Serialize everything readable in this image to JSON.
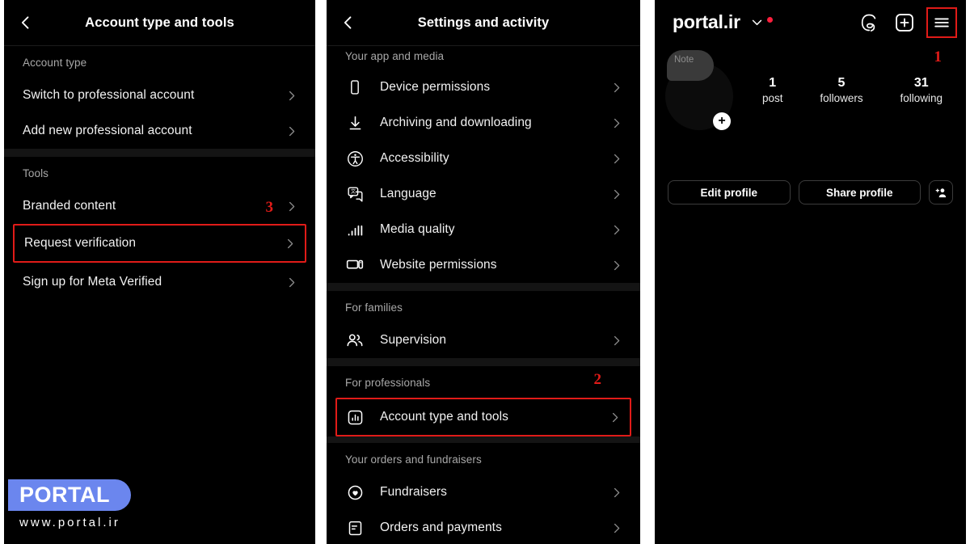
{
  "theme": {
    "background": "#000000",
    "accent_red": "#e01b18",
    "text_primary": "#f2f2f2",
    "text_secondary": "#a8a8a8",
    "watermark_blue": "#6b86ee",
    "notification_dot": "#ff1f3d"
  },
  "panel_account_tools": {
    "title": "Account type and tools",
    "back_icon": "back-chevron-icon",
    "sections": [
      {
        "label": "Account type",
        "items": [
          {
            "label": "Switch to professional account",
            "chevron": "chevron-right-icon",
            "highlighted": false
          },
          {
            "label": "Add new professional account",
            "chevron": "chevron-right-icon",
            "highlighted": false
          }
        ]
      },
      {
        "label": "Tools",
        "items": [
          {
            "label": "Branded content",
            "chevron": "chevron-right-icon",
            "highlighted": false
          },
          {
            "label": "Request verification",
            "chevron": "chevron-right-icon",
            "highlighted": true
          },
          {
            "label": "Sign up for Meta Verified",
            "chevron": "chevron-right-icon",
            "highlighted": false
          }
        ]
      }
    ],
    "step_number": "3"
  },
  "panel_settings": {
    "title": "Settings and activity",
    "back_icon": "back-chevron-icon",
    "sections": [
      {
        "label": "Your app and media",
        "items": [
          {
            "label": "Device permissions",
            "icon": "phone-icon",
            "highlighted": false
          },
          {
            "label": "Archiving and downloading",
            "icon": "download-icon",
            "highlighted": false
          },
          {
            "label": "Accessibility",
            "icon": "accessibility-icon",
            "highlighted": false
          },
          {
            "label": "Language",
            "icon": "language-icon",
            "highlighted": false
          },
          {
            "label": "Media quality",
            "icon": "media-quality-icon",
            "highlighted": false
          },
          {
            "label": "Website permissions",
            "icon": "website-icon",
            "highlighted": false
          }
        ]
      },
      {
        "label": "For families",
        "items": [
          {
            "label": "Supervision",
            "icon": "supervision-icon",
            "highlighted": false
          }
        ]
      },
      {
        "label": "For professionals",
        "items": [
          {
            "label": "Account type and tools",
            "icon": "account-tools-icon",
            "highlighted": true
          }
        ]
      },
      {
        "label": "Your orders and fundraisers",
        "items": [
          {
            "label": "Fundraisers",
            "icon": "fundraiser-icon",
            "highlighted": false
          },
          {
            "label": "Orders and payments",
            "icon": "orders-icon",
            "highlighted": false
          }
        ]
      }
    ],
    "step_number": "2"
  },
  "panel_profile": {
    "username": "portal.ir",
    "username_chevron": "chevron-down-icon",
    "has_notification_dot": true,
    "header_icons": [
      {
        "name": "threads-icon",
        "highlighted": false
      },
      {
        "name": "new-post-icon",
        "highlighted": false
      },
      {
        "name": "hamburger-menu-icon",
        "highlighted": true
      }
    ],
    "note_bubble_text": "Note",
    "avatar_add_glyph": "+",
    "stats": [
      {
        "value": "1",
        "caption": "post"
      },
      {
        "value": "5",
        "caption": "followers"
      },
      {
        "value": "31",
        "caption": "following"
      }
    ],
    "actions": {
      "edit_profile": "Edit profile",
      "share_profile": "Share profile",
      "add_person_icon": "add-person-icon"
    },
    "step_number": "1"
  },
  "watermark": {
    "brand": "PORTAL",
    "url": "www.portal.ir"
  }
}
